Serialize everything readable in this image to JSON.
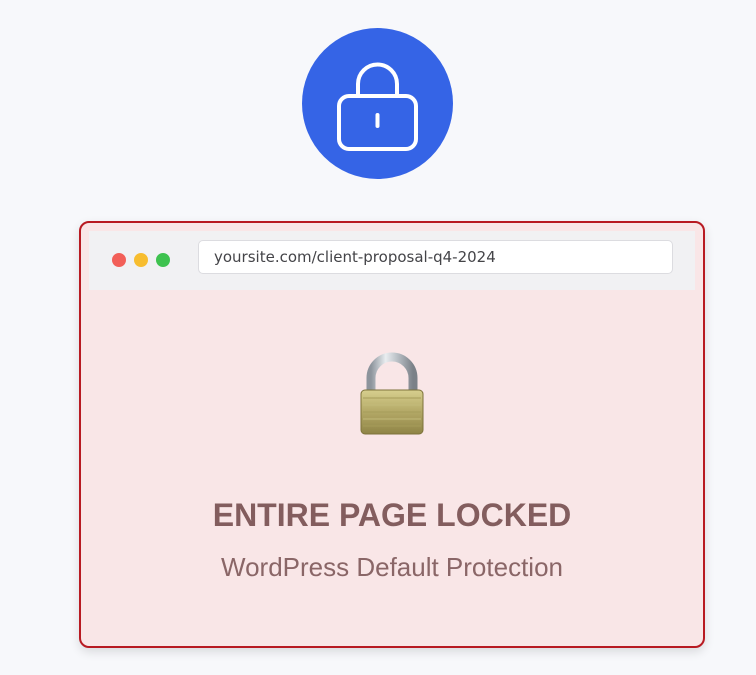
{
  "badge": {
    "icon": "lock-outline-icon",
    "color": "#3564e6"
  },
  "browser": {
    "window_controls": [
      "close",
      "minimize",
      "maximize"
    ],
    "url": "yoursite.com/client-proposal-q4-2024",
    "border_color": "#b81a22"
  },
  "content": {
    "icon": "padlock-icon",
    "title": "ENTIRE PAGE LOCKED",
    "subtitle": "WordPress Default Protection"
  }
}
